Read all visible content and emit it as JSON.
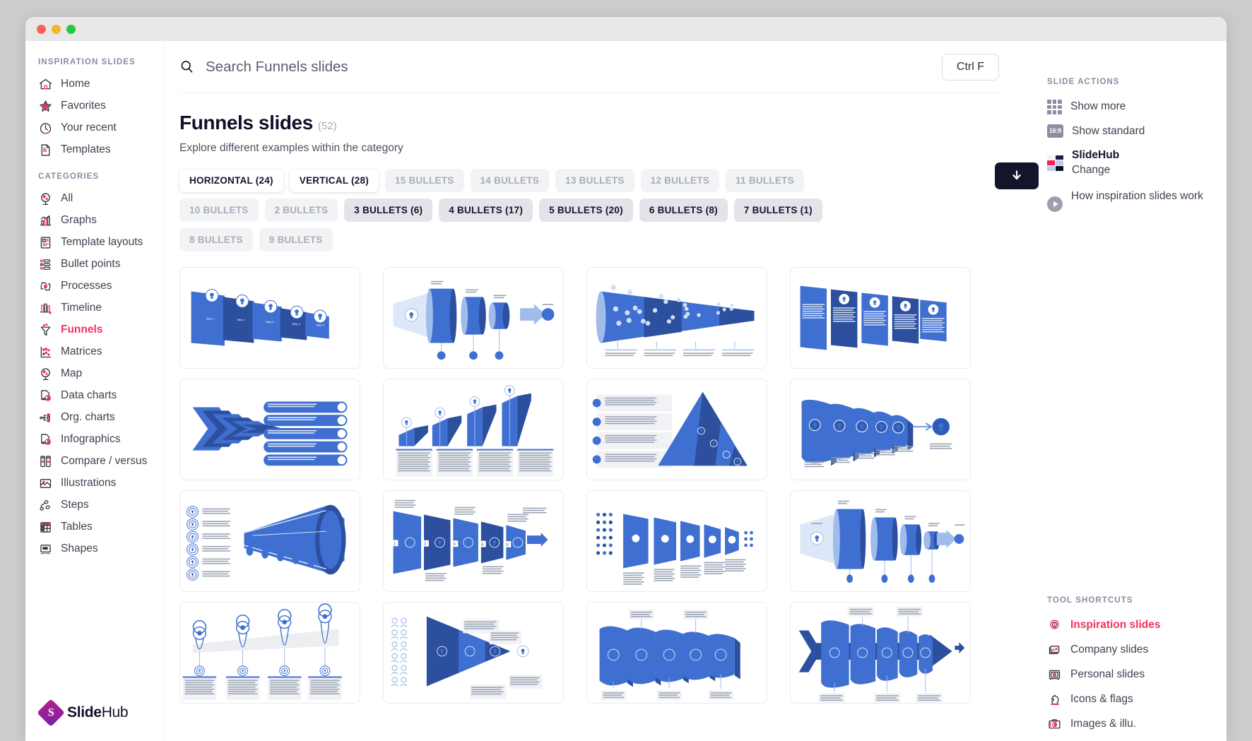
{
  "window": {
    "traffic_lights": [
      "close",
      "minimize",
      "maximize"
    ]
  },
  "sidebar": {
    "heading": "INSPIRATION SLIDES",
    "top_items": [
      {
        "label": "Home",
        "icon": "home-icon"
      },
      {
        "label": "Favorites",
        "icon": "star-icon"
      },
      {
        "label": "Your recent",
        "icon": "clock-icon"
      },
      {
        "label": "Templates",
        "icon": "document-icon"
      }
    ],
    "categories_heading": "CATEGORIES",
    "categories": [
      {
        "label": "All",
        "icon": "globe-icon",
        "active": false
      },
      {
        "label": "Graphs",
        "icon": "bar-chart-icon",
        "active": false
      },
      {
        "label": "Template layouts",
        "icon": "layout-icon",
        "active": false
      },
      {
        "label": "Bullet points",
        "icon": "list-icon",
        "active": false
      },
      {
        "label": "Processes",
        "icon": "cycle-icon",
        "active": false
      },
      {
        "label": "Timeline",
        "icon": "timeline-icon",
        "active": false
      },
      {
        "label": "Funnels",
        "icon": "funnel-icon",
        "active": true
      },
      {
        "label": "Matrices",
        "icon": "matrix-icon",
        "active": false
      },
      {
        "label": "Map",
        "icon": "globe-icon",
        "active": false
      },
      {
        "label": "Data charts",
        "icon": "pie-doc-icon",
        "active": false
      },
      {
        "label": "Org. charts",
        "icon": "org-chart-icon",
        "active": false
      },
      {
        "label": "Infographics",
        "icon": "pie-doc-icon",
        "active": false
      },
      {
        "label": "Compare / versus",
        "icon": "compare-icon",
        "active": false
      },
      {
        "label": "Illustrations",
        "icon": "image-icon",
        "active": false
      },
      {
        "label": "Steps",
        "icon": "steps-icon",
        "active": false
      },
      {
        "label": "Tables",
        "icon": "table-icon",
        "active": false
      },
      {
        "label": "Shapes",
        "icon": "shapes-icon",
        "active": false
      }
    ],
    "brand": {
      "mark_letter": "S",
      "name_bold": "Slide",
      "name_rest": "Hub"
    }
  },
  "search": {
    "placeholder": "Search Funnels slides",
    "value": "Search Funnels slides",
    "icon": "search-icon",
    "shortcut_label": "Ctrl F"
  },
  "page": {
    "title": "Funnels slides",
    "count": "(52)",
    "subtitle": "Explore different examples within the category"
  },
  "filters": [
    {
      "label": "HORIZONTAL (24)",
      "state": "selected-strong"
    },
    {
      "label": "VERTICAL (28)",
      "state": "selected-strong"
    },
    {
      "label": "15 BULLETS",
      "state": "muted"
    },
    {
      "label": "14 BULLETS",
      "state": "muted"
    },
    {
      "label": "13 BULLETS",
      "state": "muted"
    },
    {
      "label": "12 BULLETS",
      "state": "muted"
    },
    {
      "label": "11 BULLETS",
      "state": "muted"
    },
    {
      "label": "10 BULLETS",
      "state": "muted"
    },
    {
      "label": "2 BULLETS",
      "state": "muted"
    },
    {
      "label": "3 BULLETS (6)",
      "state": "selected-soft"
    },
    {
      "label": "4 BULLETS (17)",
      "state": "selected-soft"
    },
    {
      "label": "5 BULLETS (20)",
      "state": "selected-soft"
    },
    {
      "label": "6 BULLETS (8)",
      "state": "selected-soft"
    },
    {
      "label": "7 BULLETS (1)",
      "state": "selected-soft"
    },
    {
      "label": "8 BULLETS",
      "state": "muted"
    },
    {
      "label": "9 BULLETS",
      "state": "muted"
    }
  ],
  "thumbnails": [
    {
      "name": "stacked-cards-funnel"
    },
    {
      "name": "cylinder-cone-funnel"
    },
    {
      "name": "dotted-cone-funnel"
    },
    {
      "name": "angled-panels-funnel"
    },
    {
      "name": "nested-arrow-funnel-list"
    },
    {
      "name": "zigzag-growth-funnel"
    },
    {
      "name": "triangle-pyramid-funnel"
    },
    {
      "name": "ribbon-wave-funnel"
    },
    {
      "name": "megaphone-cone-funnel"
    },
    {
      "name": "numbered-panels-funnel"
    },
    {
      "name": "dots-panels-funnel"
    },
    {
      "name": "cylinders-arrow-funnel"
    },
    {
      "name": "pin-markers-funnel"
    },
    {
      "name": "people-triangle-funnel"
    },
    {
      "name": "wave-strip-funnel"
    },
    {
      "name": "arrow-spine-funnel"
    }
  ],
  "slide_actions": {
    "heading": "SLIDE ACTIONS",
    "items": [
      {
        "label": "Show more",
        "icon": "grid-icon"
      },
      {
        "label": "Show standard",
        "icon": "ratio-16-9-icon",
        "badge": "16:9"
      }
    ],
    "theme": {
      "name": "SlideHub",
      "change_label": "Change",
      "icon": "color-swatch-icon",
      "colors": [
        "#f2f3f6",
        "#1c1f45",
        "#f5224f",
        "#c3c8ef",
        "#c3c8ef",
        "#0b0d26"
      ]
    },
    "how_it_works": {
      "label": "How inspiration slides work",
      "icon": "play-icon"
    }
  },
  "tool_shortcuts": {
    "heading": "TOOL SHORTCUTS",
    "items": [
      {
        "label": "Inspiration slides",
        "icon": "bulb-gear-icon",
        "active": true
      },
      {
        "label": "Company slides",
        "icon": "presentation-icon",
        "active": false
      },
      {
        "label": "Personal slides",
        "icon": "safe-box-icon",
        "active": false
      },
      {
        "label": "Icons & flags",
        "icon": "chess-knight-icon",
        "active": false
      },
      {
        "label": "Images & illu.",
        "icon": "camera-icon",
        "active": false
      }
    ]
  },
  "download_button": {
    "icon": "download-arrow-icon",
    "label": ""
  },
  "colors": {
    "accent": "#f0325c",
    "dark": "#14142b",
    "muted": "#8b8ba3",
    "chip_bg": "#f2f3f5",
    "slide_blue": "#3f6fd0",
    "slide_blue_dark": "#2b4c9b",
    "slide_blue_light": "#8fb0e8"
  }
}
